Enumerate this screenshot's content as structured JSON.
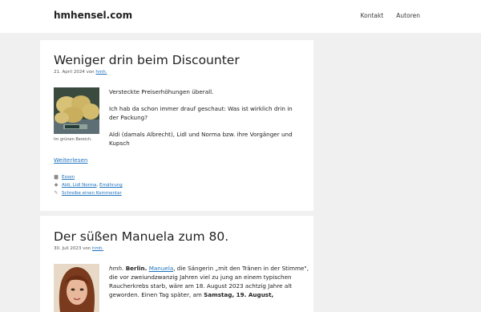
{
  "site": {
    "title": "hmhensel.com"
  },
  "nav": {
    "items": [
      {
        "label": "Kontakt"
      },
      {
        "label": "Autoren"
      }
    ]
  },
  "posts": [
    {
      "title": "Weniger drin beim Discounter",
      "date": "21. April 2024",
      "by": "von",
      "author": "hmh.",
      "image_caption": "Im grünen Bereich.",
      "paragraphs": [
        "Versteckte Preiserhöhungen überall.",
        "Ich hab da schon immer drauf geschaut: Was ist wirklich drin in der Packung?",
        "Aldi (damals Albrecht), Lidl und Norma bzw. ihre Vorgänger und Kupsch"
      ],
      "read_more": "Weiterlesen",
      "category": "Essen",
      "tags": [
        "Aldi, Lidl Norma",
        "Ernährung"
      ],
      "tag_sep": ", ",
      "comment_link": "Schreibe einen Kommentar"
    },
    {
      "title": "Der süßen Manuela zum 80.",
      "date": "30. Juli 2023",
      "by": "von",
      "author": "hmh.",
      "excerpt": {
        "author_prefix": "hmh.",
        "place": "Berlin.",
        "link": "Manuela",
        "text1": ", die Sängerin „mit den Tränen in der Stimme\", die vor zweiundzwanzig Jahren viel zu jung an einem typischen Raucherkrebs starb, wäre am 18. August 2023 achtzig Jahre alt geworden. Einen Tag später, am ",
        "bold": "Samstag, 19. August,"
      }
    }
  ],
  "colors": {
    "link": "#1e73be",
    "background": "#f0f0f0",
    "card": "#ffffff"
  }
}
